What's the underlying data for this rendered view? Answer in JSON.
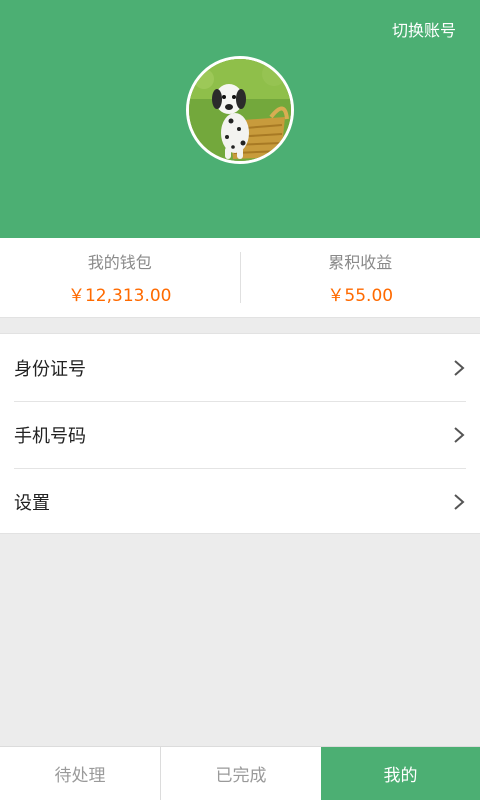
{
  "header": {
    "switch_account": "切换账号",
    "avatar_icon": "dalmatian-puppy-avatar",
    "bg_color": "#4caf73"
  },
  "stats": [
    {
      "label": "我的钱包",
      "value": "￥12,313.00"
    },
    {
      "label": "累积收益",
      "value": "￥55.00"
    }
  ],
  "value_color": "#ff6a00",
  "menu": [
    {
      "label": "身份证号",
      "icon": "chevron-right-icon"
    },
    {
      "label": "手机号码",
      "icon": "chevron-right-icon"
    },
    {
      "label": "设置",
      "icon": "chevron-right-icon"
    }
  ],
  "tabs": [
    {
      "label": "待处理",
      "active": false
    },
    {
      "label": "已完成",
      "active": false
    },
    {
      "label": "我的",
      "active": true
    }
  ]
}
